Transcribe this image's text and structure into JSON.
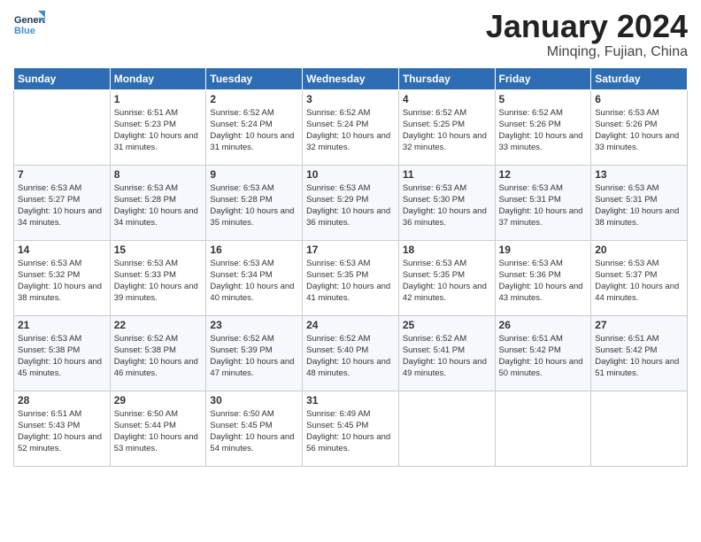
{
  "header": {
    "logo_general": "General",
    "logo_blue": "Blue",
    "month_year": "January 2024",
    "location": "Minqing, Fujian, China"
  },
  "days_of_week": [
    "Sunday",
    "Monday",
    "Tuesday",
    "Wednesday",
    "Thursday",
    "Friday",
    "Saturday"
  ],
  "weeks": [
    [
      {
        "day": "",
        "content": ""
      },
      {
        "day": "1",
        "content": "Sunrise: 6:51 AM\nSunset: 5:23 PM\nDaylight: 10 hours\nand 31 minutes."
      },
      {
        "day": "2",
        "content": "Sunrise: 6:52 AM\nSunset: 5:24 PM\nDaylight: 10 hours\nand 31 minutes."
      },
      {
        "day": "3",
        "content": "Sunrise: 6:52 AM\nSunset: 5:24 PM\nDaylight: 10 hours\nand 32 minutes."
      },
      {
        "day": "4",
        "content": "Sunrise: 6:52 AM\nSunset: 5:25 PM\nDaylight: 10 hours\nand 32 minutes."
      },
      {
        "day": "5",
        "content": "Sunrise: 6:52 AM\nSunset: 5:26 PM\nDaylight: 10 hours\nand 33 minutes."
      },
      {
        "day": "6",
        "content": "Sunrise: 6:53 AM\nSunset: 5:26 PM\nDaylight: 10 hours\nand 33 minutes."
      }
    ],
    [
      {
        "day": "7",
        "content": "Sunrise: 6:53 AM\nSunset: 5:27 PM\nDaylight: 10 hours\nand 34 minutes."
      },
      {
        "day": "8",
        "content": "Sunrise: 6:53 AM\nSunset: 5:28 PM\nDaylight: 10 hours\nand 34 minutes."
      },
      {
        "day": "9",
        "content": "Sunrise: 6:53 AM\nSunset: 5:28 PM\nDaylight: 10 hours\nand 35 minutes."
      },
      {
        "day": "10",
        "content": "Sunrise: 6:53 AM\nSunset: 5:29 PM\nDaylight: 10 hours\nand 36 minutes."
      },
      {
        "day": "11",
        "content": "Sunrise: 6:53 AM\nSunset: 5:30 PM\nDaylight: 10 hours\nand 36 minutes."
      },
      {
        "day": "12",
        "content": "Sunrise: 6:53 AM\nSunset: 5:31 PM\nDaylight: 10 hours\nand 37 minutes."
      },
      {
        "day": "13",
        "content": "Sunrise: 6:53 AM\nSunset: 5:31 PM\nDaylight: 10 hours\nand 38 minutes."
      }
    ],
    [
      {
        "day": "14",
        "content": "Sunrise: 6:53 AM\nSunset: 5:32 PM\nDaylight: 10 hours\nand 38 minutes."
      },
      {
        "day": "15",
        "content": "Sunrise: 6:53 AM\nSunset: 5:33 PM\nDaylight: 10 hours\nand 39 minutes."
      },
      {
        "day": "16",
        "content": "Sunrise: 6:53 AM\nSunset: 5:34 PM\nDaylight: 10 hours\nand 40 minutes."
      },
      {
        "day": "17",
        "content": "Sunrise: 6:53 AM\nSunset: 5:35 PM\nDaylight: 10 hours\nand 41 minutes."
      },
      {
        "day": "18",
        "content": "Sunrise: 6:53 AM\nSunset: 5:35 PM\nDaylight: 10 hours\nand 42 minutes."
      },
      {
        "day": "19",
        "content": "Sunrise: 6:53 AM\nSunset: 5:36 PM\nDaylight: 10 hours\nand 43 minutes."
      },
      {
        "day": "20",
        "content": "Sunrise: 6:53 AM\nSunset: 5:37 PM\nDaylight: 10 hours\nand 44 minutes."
      }
    ],
    [
      {
        "day": "21",
        "content": "Sunrise: 6:53 AM\nSunset: 5:38 PM\nDaylight: 10 hours\nand 45 minutes."
      },
      {
        "day": "22",
        "content": "Sunrise: 6:52 AM\nSunset: 5:38 PM\nDaylight: 10 hours\nand 46 minutes."
      },
      {
        "day": "23",
        "content": "Sunrise: 6:52 AM\nSunset: 5:39 PM\nDaylight: 10 hours\nand 47 minutes."
      },
      {
        "day": "24",
        "content": "Sunrise: 6:52 AM\nSunset: 5:40 PM\nDaylight: 10 hours\nand 48 minutes."
      },
      {
        "day": "25",
        "content": "Sunrise: 6:52 AM\nSunset: 5:41 PM\nDaylight: 10 hours\nand 49 minutes."
      },
      {
        "day": "26",
        "content": "Sunrise: 6:51 AM\nSunset: 5:42 PM\nDaylight: 10 hours\nand 50 minutes."
      },
      {
        "day": "27",
        "content": "Sunrise: 6:51 AM\nSunset: 5:42 PM\nDaylight: 10 hours\nand 51 minutes."
      }
    ],
    [
      {
        "day": "28",
        "content": "Sunrise: 6:51 AM\nSunset: 5:43 PM\nDaylight: 10 hours\nand 52 minutes."
      },
      {
        "day": "29",
        "content": "Sunrise: 6:50 AM\nSunset: 5:44 PM\nDaylight: 10 hours\nand 53 minutes."
      },
      {
        "day": "30",
        "content": "Sunrise: 6:50 AM\nSunset: 5:45 PM\nDaylight: 10 hours\nand 54 minutes."
      },
      {
        "day": "31",
        "content": "Sunrise: 6:49 AM\nSunset: 5:45 PM\nDaylight: 10 hours\nand 56 minutes."
      },
      {
        "day": "",
        "content": ""
      },
      {
        "day": "",
        "content": ""
      },
      {
        "day": "",
        "content": ""
      }
    ]
  ]
}
